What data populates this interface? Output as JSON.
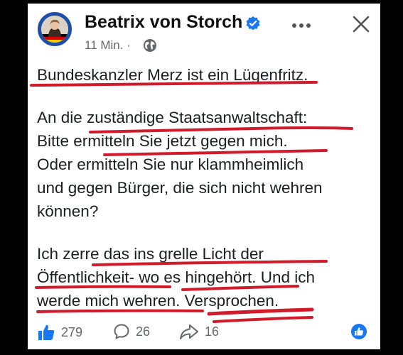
{
  "post": {
    "author": "Beatrix von Storch",
    "timestamp": "11 Min. ·",
    "verified": true,
    "lines": [
      "Bundeskanzler Merz ist ein Lügenfritz.",
      "An die zuständige Staatsanwaltschaft:",
      "Bitte ermitteln Sie jetzt gegen mich.",
      "Oder ermitteln Sie nur klammheimlich",
      "und gegen Bürger, die sich nicht wehren",
      "können?",
      "Ich zerre das ins grelle Licht der",
      "Öffentlichkeit- wo es hingehört. Und ich",
      "werde mich wehren. Versprochen."
    ]
  },
  "reactions": {
    "likes": "279",
    "comments": "26",
    "shares": "16"
  },
  "icons": [
    "verified-badge-icon",
    "globe-icon",
    "more-icon",
    "close-icon",
    "like-icon",
    "comment-icon",
    "share-icon",
    "like-reaction-icon"
  ],
  "colors": {
    "accent_blue": "#1877f2",
    "underline_red": "#d11a2a",
    "text": "#1c1e21",
    "meta": "#65676b"
  }
}
